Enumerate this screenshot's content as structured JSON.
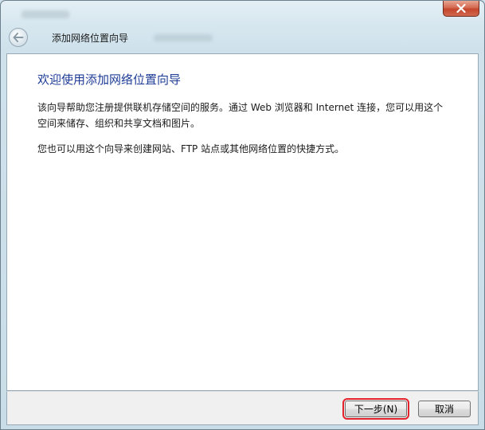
{
  "window": {
    "header_title": "添加网络位置向导",
    "close_symbol": "✕"
  },
  "content": {
    "heading": "欢迎使用添加网络位置向导",
    "paragraph1": "该向导帮助您注册提供联机存储空间的服务。通过 Web 浏览器和 Internet 连接，您可以用这个空间来储存、组织和共享文档和图片。",
    "paragraph2": "您也可以用这个向导来创建网站、FTP 站点或其他网络位置的快捷方式。"
  },
  "footer": {
    "next_label": "下一步(N)",
    "cancel_label": "取消"
  },
  "colors": {
    "heading": "#1e3c96",
    "highlight": "#e3222b",
    "close_button": "#c4452c"
  },
  "icons": {
    "back": "back-arrow-icon",
    "close": "close-icon"
  }
}
